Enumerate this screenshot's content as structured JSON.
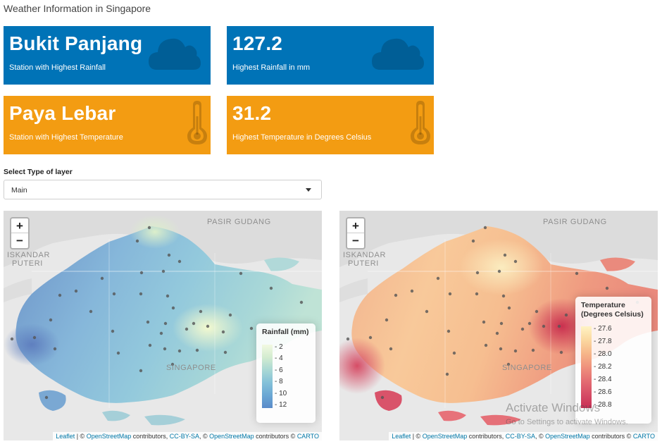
{
  "page": {
    "title": "Weather Information in Singapore"
  },
  "value_boxes": [
    {
      "value": "Bukit Panjang",
      "subtitle": "Station with Highest Rainfall",
      "icon": "cloud-icon",
      "color": "#0073b7"
    },
    {
      "value": "127.2",
      "subtitle": "Highest Rainfall in mm",
      "icon": "cloud-icon",
      "color": "#0073b7"
    },
    {
      "value": "Paya Lebar",
      "subtitle": "Station with Highest Temperature",
      "icon": "thermometer-icon",
      "color": "#f39c12"
    },
    {
      "value": "31.2",
      "subtitle": "Highest Temperature in Degrees Celsius",
      "icon": "thermometer-icon",
      "color": "#f39c12"
    }
  ],
  "layer_select": {
    "label": "Select Type of layer",
    "value": "Main"
  },
  "maps": {
    "zoom_in": "+",
    "zoom_out": "−",
    "place_labels": {
      "pasir_gudang": "PASIR GUDANG",
      "iskandar": "ISKANDAR",
      "puteri": "PUTERI",
      "singapore": "SINGAPORE"
    },
    "attribution": {
      "leaflet": "Leaflet",
      "sep": " | © ",
      "osm": "OpenStreetMap",
      "contributors": " contributors, ",
      "ccbysa": "CC-BY-SA",
      "comma_c": ", © ",
      "osm2": "OpenStreetMap",
      "contributors2": " contributors © ",
      "carto": "CARTO"
    },
    "rainfall_legend": {
      "title": "Rainfall (mm)",
      "ticks": [
        "2",
        "4",
        "6",
        "8",
        "10",
        "12"
      ],
      "colors": [
        "#f2f9e2",
        "#d3ecd0",
        "#a9d8d4",
        "#84c1d8",
        "#6aa7d4",
        "#5a8bc9"
      ]
    },
    "temperature_legend": {
      "title_line1": "Temperature",
      "title_line2": "(Degrees Celsius)",
      "ticks": [
        "27.6",
        "27.8",
        "28.0",
        "28.2",
        "28.4",
        "28.6",
        "28.8"
      ],
      "colors": [
        "#fff3c4",
        "#fbd8a0",
        "#f6b689",
        "#ef917d",
        "#e46d72",
        "#d64d66",
        "#c92f55"
      ]
    }
  },
  "os_overlay": {
    "line1": "Activate Windows",
    "line2": "Go to Settings to activate Windows."
  }
}
